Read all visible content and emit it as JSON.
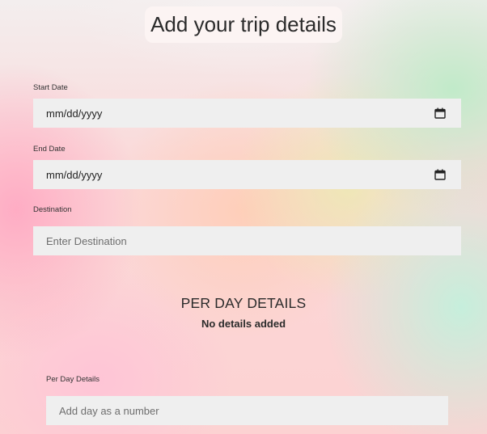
{
  "page_title": "Add your trip details",
  "form": {
    "start_date": {
      "label": "Start Date",
      "value": "mm/dd/yyyy",
      "icon": "calendar-icon"
    },
    "end_date": {
      "label": "End Date",
      "value": "mm/dd/yyyy",
      "icon": "calendar-icon"
    },
    "destination": {
      "label": "Destination",
      "placeholder": "Enter Destination"
    }
  },
  "per_day": {
    "heading": "PER DAY DETAILS",
    "empty_message": "No details added",
    "field_label": "Per Day Details",
    "day_placeholder": "Add day as a number"
  },
  "colors": {
    "field_background": "#efefef",
    "text": "#2b2b2b",
    "placeholder": "#6e6e6e"
  }
}
